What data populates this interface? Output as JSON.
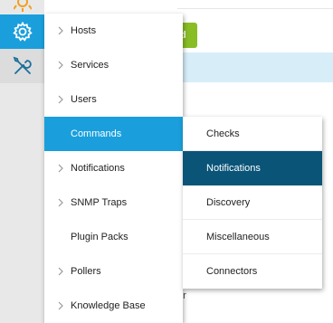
{
  "background": {
    "button_fragment": "d",
    "text_fragment": "er"
  },
  "menu": {
    "items": [
      {
        "label": "Hosts",
        "chevron": true
      },
      {
        "label": "Services",
        "chevron": true
      },
      {
        "label": "Users",
        "chevron": true
      },
      {
        "label": "Commands",
        "chevron": false,
        "active": true
      },
      {
        "label": "Notifications",
        "chevron": true
      },
      {
        "label": "SNMP Traps",
        "chevron": true
      },
      {
        "label": "Plugin Packs",
        "chevron": false
      },
      {
        "label": "Pollers",
        "chevron": true
      },
      {
        "label": "Knowledge Base",
        "chevron": true
      }
    ]
  },
  "submenu": {
    "items": [
      {
        "label": "Checks"
      },
      {
        "label": "Notifications",
        "active": true
      },
      {
        "label": "Discovery"
      },
      {
        "label": "Miscellaneous"
      },
      {
        "label": "Connectors"
      }
    ]
  },
  "colors": {
    "accent": "#1a9fdc",
    "active_sub": "#0a5478",
    "green": "#88bd25"
  }
}
